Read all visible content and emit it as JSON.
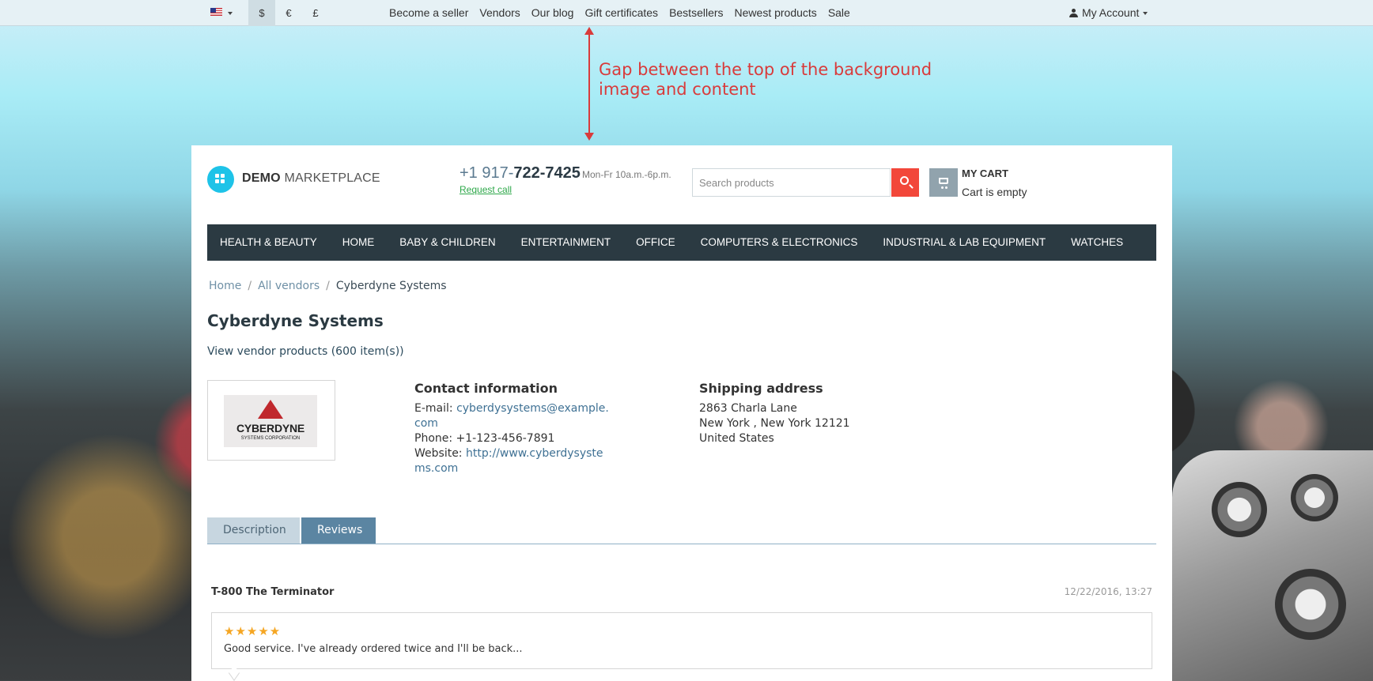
{
  "topbar": {
    "language_icon": "us-flag-icon",
    "currencies": [
      "$",
      "€",
      "£"
    ],
    "active_currency": "$",
    "links": [
      "Become a seller",
      "Vendors",
      "Our blog",
      "Gift certificates",
      "Bestsellers",
      "Newest products",
      "Sale"
    ],
    "account_label": "My Account"
  },
  "annotation": {
    "text": "Gap between the top of the background image and content",
    "color": "#d93b3b"
  },
  "header": {
    "logo_bold": "DEMO",
    "logo_rest": " MARKETPLACE",
    "phone_prefix": "+1 917-",
    "phone_number": "722-7425",
    "phone_hours": "Mon-Fr 10a.m.-6p.m.",
    "request_call": "Request call",
    "search_placeholder": "Search products",
    "cart_title": "MY CART",
    "cart_status": "Cart is empty"
  },
  "nav": {
    "items": [
      "HEALTH & BEAUTY",
      "HOME",
      "BABY & CHILDREN",
      "ENTERTAINMENT",
      "OFFICE",
      "COMPUTERS & ELECTRONICS",
      "INDUSTRIAL & LAB EQUIPMENT",
      "WATCHES"
    ]
  },
  "breadcrumb": {
    "home": "Home",
    "separator": "/",
    "all_vendors": "All vendors",
    "current": "Cyberdyne Systems"
  },
  "vendor": {
    "title": "Cyberdyne Systems",
    "products_link": "View vendor products (600 item(s))",
    "logo_brand": "CYBERDYNE",
    "logo_sub": "SYSTEMS CORPORATION",
    "contact": {
      "heading": "Contact information",
      "email_label": "E-mail: ",
      "email": "cyberdysystems@example.com",
      "phone_label": "Phone: ",
      "phone": "+1-123-456-7891",
      "website_label": "Website: ",
      "website": "http://www.cyberdysystems.com"
    },
    "shipping": {
      "heading": "Shipping address",
      "line1": "2863 Charla Lane",
      "line2": "New York , New York 12121",
      "line3": "United States"
    }
  },
  "tabs": {
    "description": "Description",
    "reviews": "Reviews",
    "active": "Reviews"
  },
  "review": {
    "author": "T-800 The Terminator",
    "date": "12/22/2016, 13:27",
    "rating": 5,
    "stars": "★★★★★",
    "text": "Good service. I've already ordered twice and I'll be back..."
  },
  "colors": {
    "accent": "#f2473a",
    "nav_bg": "#2b3a42",
    "logo": "#1ec3e8",
    "tab_active": "#5b85a2",
    "star": "#f5a623"
  }
}
